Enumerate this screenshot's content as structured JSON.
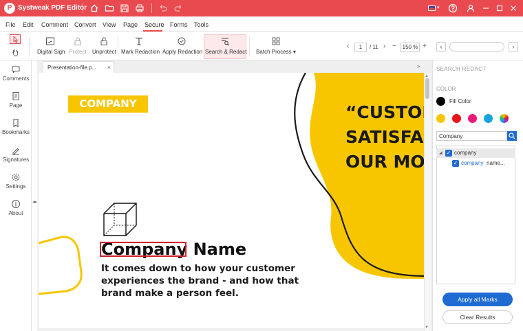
{
  "app": {
    "title": "Systweak PDF Editor",
    "logo_letter": "P",
    "accent_color": "#e84a4f",
    "titlebar_icons": [
      "home-icon",
      "folder-icon",
      "save-icon",
      "print-icon",
      "undo-icon",
      "redo-icon"
    ],
    "right_icons": [
      "flag-us-icon",
      "help-icon",
      "user-icon",
      "minimize-icon",
      "maximize-icon",
      "close-icon"
    ],
    "language_caret": "▾"
  },
  "menu": {
    "items": [
      "File",
      "Edit",
      "Comment",
      "Convert",
      "View",
      "Page",
      "Secure",
      "Forms",
      "Tools"
    ],
    "active": "Secure"
  },
  "toolbar": {
    "tools": [
      {
        "label": "Digital Sign",
        "icon": "digital-sign-icon",
        "enabled": true
      },
      {
        "label": "Protect",
        "icon": "lock-icon",
        "enabled": false
      },
      {
        "label": "Unprotect",
        "icon": "unlock-icon",
        "enabled": true
      },
      {
        "label": "Mark Redaction",
        "icon": "mark-redaction-icon",
        "enabled": true
      },
      {
        "label": "Apply Redaction",
        "icon": "apply-redaction-icon",
        "enabled": true
      },
      {
        "label": "Search & Redact",
        "icon": "search-redact-icon",
        "enabled": true,
        "active": true
      },
      {
        "label": "Batch Process",
        "icon": "batch-process-icon",
        "enabled": true,
        "has_dropdown": true
      }
    ],
    "batch_caret": "▾",
    "page_current": "1",
    "page_total": "/ 11",
    "zoom": "150 %",
    "zoom_minus": "−",
    "zoom_plus": "+",
    "prev": "‹",
    "next": "›",
    "search_placeholder": ""
  },
  "sidebar": {
    "items": [
      {
        "label": "Comments",
        "icon": "comments-icon"
      },
      {
        "label": "Page",
        "icon": "page-icon"
      },
      {
        "label": "Bookmarks",
        "icon": "bookmark-icon"
      },
      {
        "label": "Signatures",
        "icon": "signature-icon"
      },
      {
        "label": "Settings",
        "icon": "settings-icon"
      },
      {
        "label": "About",
        "icon": "info-icon"
      }
    ],
    "collapse_glyph": "◂▸"
  },
  "document": {
    "tab_title": "Presentation-file.p...",
    "tab_close": "×",
    "expand_glyph": "»",
    "badge": "COMPANY",
    "quote": "“CUSTOM\nSATISFAC\nOUR MOT",
    "title_highlight": "Company",
    "title_rest": " Name",
    "body": "It comes down to how your customer experiences the brand - and how that brand make a person feel.",
    "yellow_color": "#f7c600",
    "scroll_up": "▲",
    "scroll_down": "▼"
  },
  "redact_panel": {
    "title": "SEARCH REDACT",
    "color_heading": "COLOR",
    "fill_label": "Fill Color",
    "swatches": [
      "#f7c600",
      "#e8141b",
      "#ea1a77",
      "#18a4e0",
      "rainbow"
    ],
    "search_value": "Company",
    "tree": {
      "root": "company",
      "child_match": "company",
      "child_context": "name...",
      "checkmark": "✓"
    },
    "apply_label": "Apply all Marks",
    "clear_label": "Clear Results"
  }
}
